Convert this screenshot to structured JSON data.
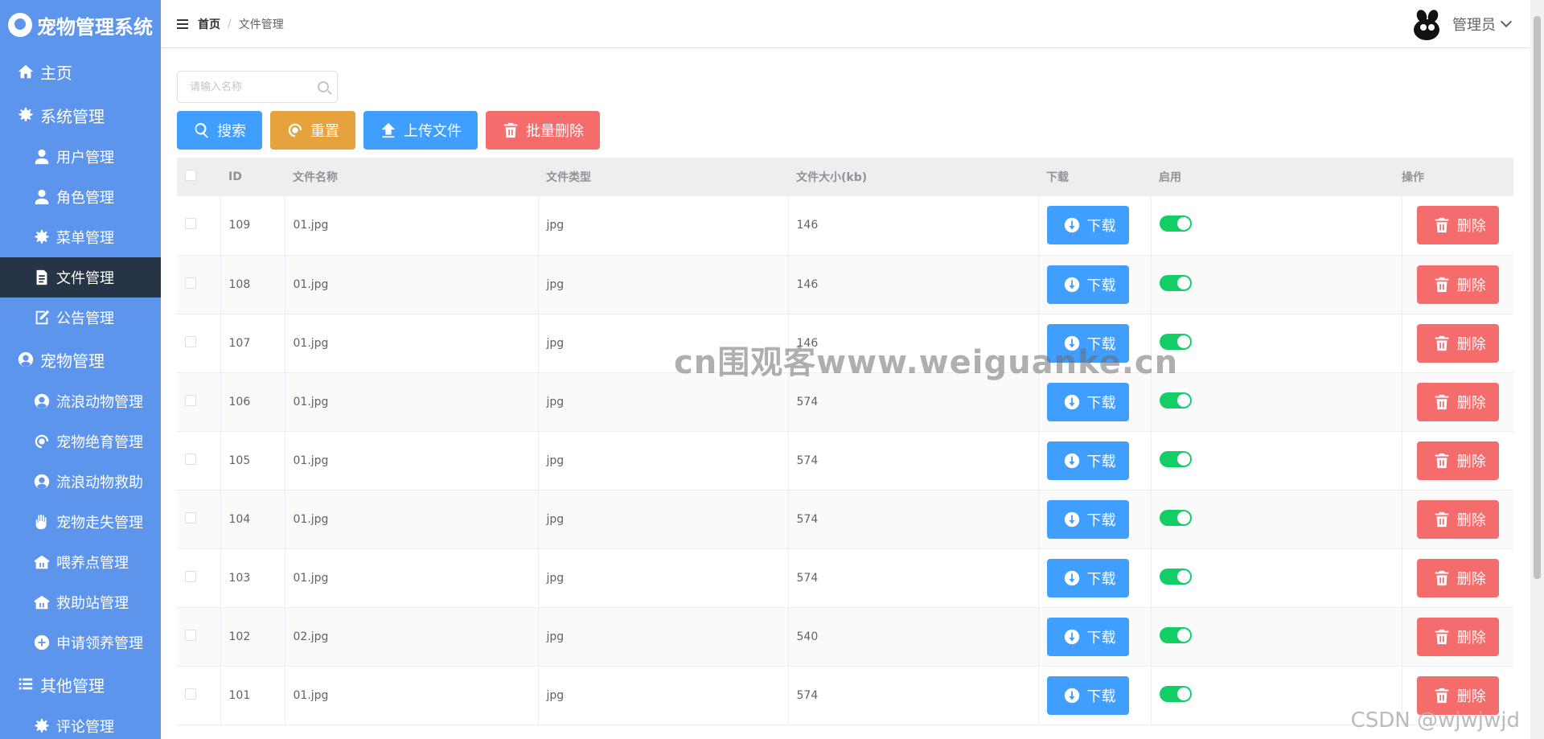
{
  "app": {
    "title": "宠物管理系统"
  },
  "sidebar": {
    "items": [
      {
        "label": "主页",
        "icon": "home-icon",
        "level": "top"
      },
      {
        "label": "系统管理",
        "icon": "gear-icon",
        "level": "top"
      },
      {
        "label": "用户管理",
        "icon": "user-icon",
        "level": "sub"
      },
      {
        "label": "角色管理",
        "icon": "user-icon",
        "level": "sub"
      },
      {
        "label": "菜单管理",
        "icon": "gear-icon",
        "level": "sub"
      },
      {
        "label": "文件管理",
        "icon": "document-icon",
        "level": "sub",
        "active": true
      },
      {
        "label": "公告管理",
        "icon": "edit-icon",
        "level": "sub"
      },
      {
        "label": "宠物管理",
        "icon": "pet-icon",
        "level": "top"
      },
      {
        "label": "流浪动物管理",
        "icon": "pet-icon",
        "level": "sub"
      },
      {
        "label": "宠物绝育管理",
        "icon": "refresh-icon",
        "level": "sub"
      },
      {
        "label": "流浪动物救助",
        "icon": "pet-icon",
        "level": "sub"
      },
      {
        "label": "宠物走失管理",
        "icon": "hand-icon",
        "level": "sub"
      },
      {
        "label": "喂养点管理",
        "icon": "house-icon",
        "level": "sub"
      },
      {
        "label": "救助站管理",
        "icon": "house-icon",
        "level": "sub"
      },
      {
        "label": "申请领养管理",
        "icon": "add-circle-icon",
        "level": "sub"
      },
      {
        "label": "其他管理",
        "icon": "list-icon",
        "level": "top"
      },
      {
        "label": "评论管理",
        "icon": "gear-icon",
        "level": "sub"
      }
    ]
  },
  "header": {
    "breadcrumb_home": "首页",
    "breadcrumb_sep": "/",
    "breadcrumb_current": "文件管理",
    "user_name": "管理员"
  },
  "toolbar": {
    "search_placeholder": "请输入名称",
    "search_label": "搜索",
    "reset_label": "重置",
    "upload_label": "上传文件",
    "batch_delete_label": "批量删除"
  },
  "table": {
    "headers": {
      "id": "ID",
      "name": "文件名称",
      "type": "文件类型",
      "size": "文件大小(kb)",
      "download": "下载",
      "enable": "启用",
      "action": "操作"
    },
    "download_label": "下载",
    "delete_label": "删除",
    "rows": [
      {
        "id": "109",
        "name": "01.jpg",
        "type": "jpg",
        "size": "146"
      },
      {
        "id": "108",
        "name": "01.jpg",
        "type": "jpg",
        "size": "146"
      },
      {
        "id": "107",
        "name": "01.jpg",
        "type": "jpg",
        "size": "146"
      },
      {
        "id": "106",
        "name": "01.jpg",
        "type": "jpg",
        "size": "574"
      },
      {
        "id": "105",
        "name": "01.jpg",
        "type": "jpg",
        "size": "574"
      },
      {
        "id": "104",
        "name": "01.jpg",
        "type": "jpg",
        "size": "574"
      },
      {
        "id": "103",
        "name": "01.jpg",
        "type": "jpg",
        "size": "574"
      },
      {
        "id": "102",
        "name": "02.jpg",
        "type": "jpg",
        "size": "540"
      },
      {
        "id": "101",
        "name": "01.jpg",
        "type": "jpg",
        "size": "574"
      }
    ]
  },
  "watermark": "cn围观客www.weiguanke.cn",
  "csdn_watermark": "CSDN @wjwjwjd",
  "colors": {
    "sidebar": "#5d95ed",
    "active": "#263445",
    "primary": "#409eff",
    "warning": "#e6a23c",
    "danger": "#f56c6c",
    "switch_on": "#13ce66"
  }
}
